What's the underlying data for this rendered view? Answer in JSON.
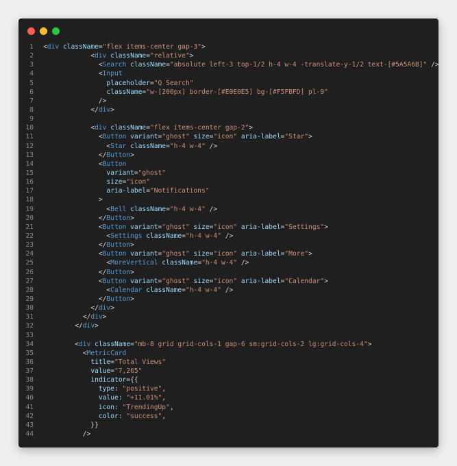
{
  "window_controls": [
    {
      "name": "close",
      "color": "#ff5f57"
    },
    {
      "name": "minimize",
      "color": "#febc2e"
    },
    {
      "name": "zoom",
      "color": "#28c840"
    }
  ],
  "colors": {
    "background": "#efefef",
    "editor_background": "#1f1f1f",
    "line_number": "#8a8a8a",
    "tag": "#569cd6",
    "attribute": "#9cdcfe",
    "string": "#ce9178",
    "punctuation": "#d4d4d4"
  },
  "lines": [
    {
      "n": "1",
      "code": "<div className=\"flex items-center gap-3\">"
    },
    {
      "n": "2",
      "code": "            <div className=\"relative\">"
    },
    {
      "n": "3",
      "code": "              <Search className=\"absolute left-3 top-1/2 h-4 w-4 -translate-y-1/2 text-[#5A5A6B]\" />"
    },
    {
      "n": "4",
      "code": "              <Input"
    },
    {
      "n": "5",
      "code": "                placeholder=\"Q Search\""
    },
    {
      "n": "6",
      "code": "                className=\"w-[200px] border-[#E0E0E5] bg-[#F5FBFD] pl-9\""
    },
    {
      "n": "7",
      "code": "              />"
    },
    {
      "n": "8",
      "code": "            </div>"
    },
    {
      "n": "9",
      "code": ""
    },
    {
      "n": "10",
      "code": "            <div className=\"flex items-center gap-2\">"
    },
    {
      "n": "11",
      "code": "              <Button variant=\"ghost\" size=\"icon\" aria-label=\"Star\">"
    },
    {
      "n": "12",
      "code": "                <Star className=\"h-4 w-4\" />"
    },
    {
      "n": "13",
      "code": "              </Button>"
    },
    {
      "n": "14",
      "code": "              <Button"
    },
    {
      "n": "15",
      "code": "                variant=\"ghost\""
    },
    {
      "n": "16",
      "code": "                size=\"icon\""
    },
    {
      "n": "17",
      "code": "                aria-label=\"Notifications\""
    },
    {
      "n": "18",
      "code": "              >"
    },
    {
      "n": "19",
      "code": "                <Bell className=\"h-4 w-4\" />"
    },
    {
      "n": "20",
      "code": "              </Button>"
    },
    {
      "n": "21",
      "code": "              <Button variant=\"ghost\" size=\"icon\" aria-label=\"Settings\">"
    },
    {
      "n": "22",
      "code": "                <Settings className=\"h-4 w-4\" />"
    },
    {
      "n": "23",
      "code": "              </Button>"
    },
    {
      "n": "24",
      "code": "              <Button variant=\"ghost\" size=\"icon\" aria-label=\"More\">"
    },
    {
      "n": "25",
      "code": "                <MoreVertical className=\"h-4 w-4\" />"
    },
    {
      "n": "26",
      "code": "              </Button>"
    },
    {
      "n": "27",
      "code": "              <Button variant=\"ghost\" size=\"icon\" aria-label=\"Calendar\">"
    },
    {
      "n": "28",
      "code": "                <Calendar className=\"h-4 w-4\" />"
    },
    {
      "n": "29",
      "code": "              </Button>"
    },
    {
      "n": "30",
      "code": "            </div>"
    },
    {
      "n": "31",
      "code": "          </div>"
    },
    {
      "n": "32",
      "code": "        </div>"
    },
    {
      "n": "33",
      "code": ""
    },
    {
      "n": "34",
      "code": "        <div className=\"mb-8 grid grid-cols-1 gap-6 sm:grid-cols-2 lg:grid-cols-4\">"
    },
    {
      "n": "35",
      "code": "          <MetricCard"
    },
    {
      "n": "36",
      "code": "            title=\"Total Views\""
    },
    {
      "n": "37",
      "code": "            value=\"7,265\""
    },
    {
      "n": "38",
      "code": "            indicator={{"
    },
    {
      "n": "39",
      "code": "              type: \"positive\","
    },
    {
      "n": "40",
      "code": "              value: \"+11.01%\","
    },
    {
      "n": "41",
      "code": "              icon: \"TrendingUp\","
    },
    {
      "n": "42",
      "code": "              color: \"success\","
    },
    {
      "n": "43",
      "code": "            }}"
    },
    {
      "n": "44",
      "code": "          />"
    }
  ]
}
